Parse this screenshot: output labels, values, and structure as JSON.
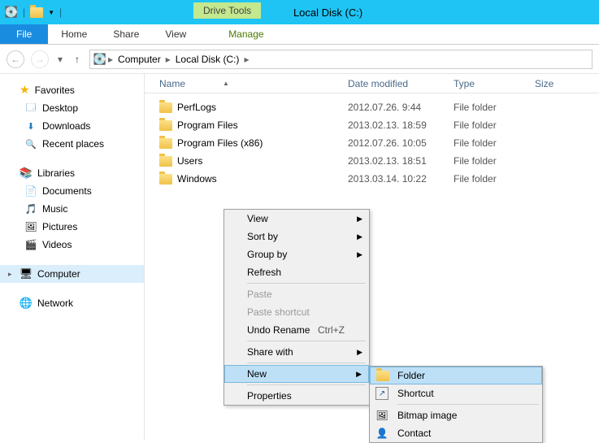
{
  "window": {
    "title": "Local Disk (C:)",
    "context_tab": "Drive Tools"
  },
  "ribbon": {
    "file": "File",
    "tabs": [
      "Home",
      "Share",
      "View"
    ],
    "manage": "Manage"
  },
  "breadcrumb": {
    "segments": [
      "Computer",
      "Local Disk (C:)"
    ]
  },
  "sidebar": {
    "favorites": {
      "label": "Favorites",
      "items": [
        {
          "label": "Desktop",
          "icon": "desk-ico"
        },
        {
          "label": "Downloads",
          "icon": "dl-ico"
        },
        {
          "label": "Recent places",
          "icon": "recent-ico"
        }
      ]
    },
    "libraries": {
      "label": "Libraries",
      "items": [
        {
          "label": "Documents",
          "icon": "doc-ico"
        },
        {
          "label": "Music",
          "icon": "mus-ico"
        },
        {
          "label": "Pictures",
          "icon": "pic-ico"
        },
        {
          "label": "Videos",
          "icon": "vid-ico"
        }
      ]
    },
    "computer": {
      "label": "Computer"
    },
    "network": {
      "label": "Network"
    }
  },
  "columns": {
    "name": "Name",
    "date": "Date modified",
    "type": "Type",
    "size": "Size"
  },
  "rows": [
    {
      "name": "PerfLogs",
      "date": "2012.07.26. 9:44",
      "type": "File folder"
    },
    {
      "name": "Program Files",
      "date": "2013.02.13. 18:59",
      "type": "File folder"
    },
    {
      "name": "Program Files (x86)",
      "date": "2012.07.26. 10:05",
      "type": "File folder"
    },
    {
      "name": "Users",
      "date": "2013.02.13. 18:51",
      "type": "File folder"
    },
    {
      "name": "Windows",
      "date": "2013.03.14. 10:22",
      "type": "File folder"
    }
  ],
  "context_menu": {
    "view": "View",
    "sort_by": "Sort by",
    "group_by": "Group by",
    "refresh": "Refresh",
    "paste": "Paste",
    "paste_shortcut": "Paste shortcut",
    "undo_rename": "Undo Rename",
    "undo_shortcut": "Ctrl+Z",
    "share_with": "Share with",
    "new": "New",
    "properties": "Properties"
  },
  "new_submenu": {
    "folder": "Folder",
    "shortcut": "Shortcut",
    "bitmap": "Bitmap image",
    "contact": "Contact"
  }
}
